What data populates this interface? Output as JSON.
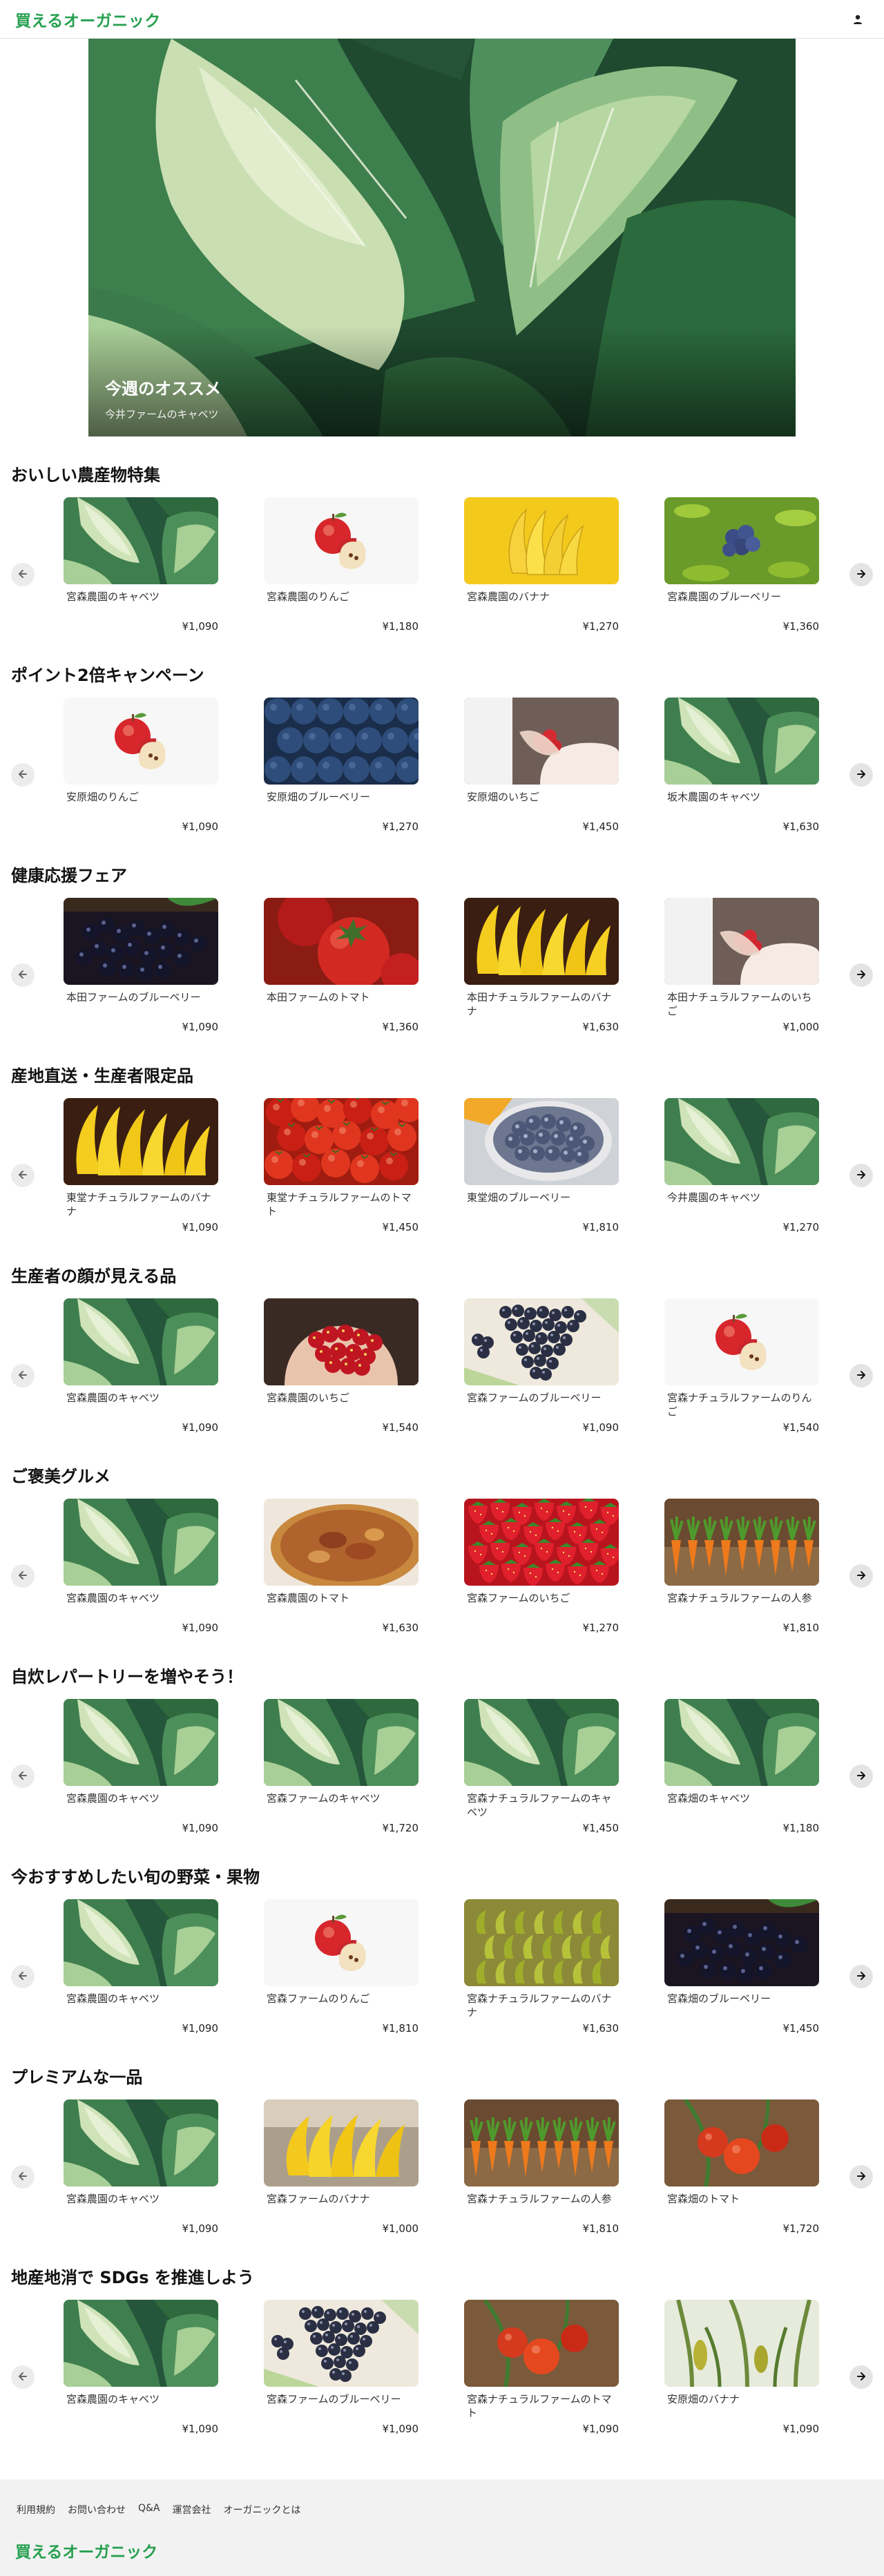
{
  "header": {
    "logo": "買えるオーガニック",
    "user_icon": "user-icon"
  },
  "hero": {
    "title": "今週のオススメ",
    "subtitle": "今井ファームのキャベツ"
  },
  "colors": {
    "brand": "#26a04f",
    "footer_bg": "#f2f2f2"
  },
  "sections": [
    {
      "title": "おいしい農産物特集",
      "items": [
        {
          "name": "宮森農園のキャベツ",
          "price": "¥1,090",
          "img": "cabbage"
        },
        {
          "name": "宮森農園のりんご",
          "price": "¥1,180",
          "img": "apple"
        },
        {
          "name": "宮森農園のバナナ",
          "price": "¥1,270",
          "img": "banana-yellow"
        },
        {
          "name": "宮森農園のブルーベリー",
          "price": "¥1,360",
          "img": "blueberry-bush"
        }
      ]
    },
    {
      "title": "ポイント2倍キャンペーン",
      "items": [
        {
          "name": "安原畑のりんご",
          "price": "¥1,090",
          "img": "apple"
        },
        {
          "name": "安原畑のブルーベリー",
          "price": "¥1,270",
          "img": "blueberry-dark"
        },
        {
          "name": "安原畑のいちご",
          "price": "¥1,450",
          "img": "strawberry-hand"
        },
        {
          "name": "坂木農園のキャベツ",
          "price": "¥1,630",
          "img": "cabbage"
        }
      ]
    },
    {
      "title": "健康応援フェア",
      "items": [
        {
          "name": "本田ファームのブルーベリー",
          "price": "¥1,090",
          "img": "blackberry"
        },
        {
          "name": "本田ファームのトマト",
          "price": "¥1,360",
          "img": "tomato-close"
        },
        {
          "name": "本田ナチュラルファームのバナナ",
          "price": "¥1,630",
          "img": "banana-bunch"
        },
        {
          "name": "本田ナチュラルファームのいちご",
          "price": "¥1,000",
          "img": "strawberry-hand"
        }
      ]
    },
    {
      "title": "産地直送・生産者限定品",
      "items": [
        {
          "name": "東堂ナチュラルファームのバナナ",
          "price": "¥1,090",
          "img": "banana-bunch"
        },
        {
          "name": "東堂ナチュラルファームのトマト",
          "price": "¥1,450",
          "img": "tomatoes"
        },
        {
          "name": "東堂畑のブルーベリー",
          "price": "¥1,810",
          "img": "blueberry-bowl"
        },
        {
          "name": "今井農園のキャベツ",
          "price": "¥1,270",
          "img": "cabbage"
        }
      ]
    },
    {
      "title": "生産者の顔が見える品",
      "items": [
        {
          "name": "宮森農園のキャベツ",
          "price": "¥1,090",
          "img": "cabbage"
        },
        {
          "name": "宮森農園のいちご",
          "price": "¥1,540",
          "img": "strawberry-hands"
        },
        {
          "name": "宮森ファームのブルーベリー",
          "price": "¥1,090",
          "img": "grapes"
        },
        {
          "name": "宮森ナチュラルファームのりんご",
          "price": "¥1,540",
          "img": "apple"
        }
      ]
    },
    {
      "title": "ご褒美グルメ",
      "items": [
        {
          "name": "宮森農園のキャベツ",
          "price": "¥1,090",
          "img": "cabbage"
        },
        {
          "name": "宮森農園のトマト",
          "price": "¥1,630",
          "img": "tart"
        },
        {
          "name": "宮森ファームのいちご",
          "price": "¥1,270",
          "img": "strawberries"
        },
        {
          "name": "宮森ナチュラルファームの人参",
          "price": "¥1,810",
          "img": "carrots"
        }
      ]
    },
    {
      "title": "自炊レパートリーを増やそう！",
      "items": [
        {
          "name": "宮森農園のキャベツ",
          "price": "¥1,090",
          "img": "cabbage"
        },
        {
          "name": "宮森ファームのキャベツ",
          "price": "¥1,720",
          "img": "cabbage"
        },
        {
          "name": "宮森ナチュラルファームのキャベツ",
          "price": "¥1,450",
          "img": "cabbage"
        },
        {
          "name": "宮森畑のキャベツ",
          "price": "¥1,180",
          "img": "cabbage"
        }
      ]
    },
    {
      "title": "今おすすめしたい旬の野菜・果物",
      "items": [
        {
          "name": "宮森農園のキャベツ",
          "price": "¥1,090",
          "img": "cabbage"
        },
        {
          "name": "宮森ファームのりんご",
          "price": "¥1,810",
          "img": "apple"
        },
        {
          "name": "宮森ナチュラルファームのバナナ",
          "price": "¥1,630",
          "img": "banana-green"
        },
        {
          "name": "宮森畑のブルーベリー",
          "price": "¥1,450",
          "img": "blackberry"
        }
      ]
    },
    {
      "title": "プレミアムな一品",
      "items": [
        {
          "name": "宮森農園のキャベツ",
          "price": "¥1,090",
          "img": "cabbage"
        },
        {
          "name": "宮森ファームのバナナ",
          "price": "¥1,000",
          "img": "banana-hang"
        },
        {
          "name": "宮森ナチュラルファームの人参",
          "price": "¥1,810",
          "img": "carrots"
        },
        {
          "name": "宮森畑のトマト",
          "price": "¥1,720",
          "img": "tomato-vine"
        }
      ]
    },
    {
      "title": "地産地消で SDGs を推進しよう",
      "items": [
        {
          "name": "宮森農園のキャベツ",
          "price": "¥1,090",
          "img": "cabbage"
        },
        {
          "name": "宮森ファームのブルーベリー",
          "price": "¥1,090",
          "img": "grapes"
        },
        {
          "name": "宮森ナチュラルファームのトマト",
          "price": "¥1,090",
          "img": "tomato-vine"
        },
        {
          "name": "安原畑のバナナ",
          "price": "¥1,090",
          "img": "banana-plant"
        }
      ]
    }
  ],
  "footer": {
    "links": [
      "利用規約",
      "お問い合わせ",
      "Q&A",
      "運営会社",
      "オーガニックとは"
    ],
    "logo": "買えるオーガニック"
  }
}
